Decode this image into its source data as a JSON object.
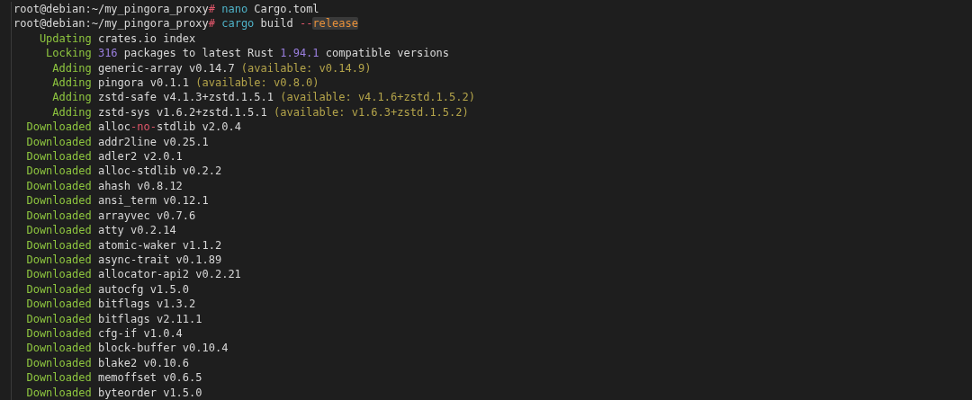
{
  "terminal": {
    "lines": [
      {
        "kind": "prompt",
        "segments": [
          {
            "text": "root@debian:~/my_pingora_proxy",
            "color": "#d8d8d8"
          },
          {
            "text": "#",
            "color": "#e0566a"
          },
          {
            "text": " nano",
            "color": "#4fb3c8"
          },
          {
            "text": " Cargo.toml",
            "color": "#d8d8d8"
          }
        ]
      },
      {
        "kind": "prompt",
        "segments": [
          {
            "text": "root@debian:~/my_pingora_proxy",
            "color": "#d8d8d8"
          },
          {
            "text": "#",
            "color": "#e0566a"
          },
          {
            "text": " cargo",
            "color": "#4fb3c8"
          },
          {
            "text": " build ",
            "color": "#d8d8d8"
          },
          {
            "text": "--",
            "color": "#e0566a"
          },
          {
            "text": "release",
            "color": "#e8913a",
            "highlighted": true
          }
        ]
      },
      {
        "kind": "status",
        "status": "Updating",
        "segments": [
          {
            "text": "crates.io index",
            "color": "#d8d8d8"
          }
        ]
      },
      {
        "kind": "status",
        "status": "Locking",
        "segments": [
          {
            "text": "316",
            "color": "#9b7fe0"
          },
          {
            "text": " packages to latest Rust ",
            "color": "#d8d8d8"
          },
          {
            "text": "1.94.1",
            "color": "#9b7fe0"
          },
          {
            "text": " compatible versions",
            "color": "#d8d8d8"
          }
        ]
      },
      {
        "kind": "status",
        "status": "Adding",
        "segments": [
          {
            "text": "generic-array v0.14.7 ",
            "color": "#d8d8d8"
          },
          {
            "text": "(available: v0.14.9)",
            "color": "#b4a44a"
          }
        ]
      },
      {
        "kind": "status",
        "status": "Adding",
        "segments": [
          {
            "text": "pingora v0.1.1 ",
            "color": "#d8d8d8"
          },
          {
            "text": "(available: v0.8.0)",
            "color": "#b4a44a"
          }
        ]
      },
      {
        "kind": "status",
        "status": "Adding",
        "segments": [
          {
            "text": "zstd-safe v4.1.3+zstd.1.5.1 ",
            "color": "#d8d8d8"
          },
          {
            "text": "(available: v4.1.6+zstd.1.5.2)",
            "color": "#b4a44a"
          }
        ]
      },
      {
        "kind": "status",
        "status": "Adding",
        "segments": [
          {
            "text": "zstd-sys v1.6.2+zstd.1.5.1 ",
            "color": "#d8d8d8"
          },
          {
            "text": "(available: v1.6.3+zstd.1.5.2)",
            "color": "#b4a44a"
          }
        ]
      },
      {
        "kind": "status",
        "status": "Downloaded",
        "segments": [
          {
            "text": "alloc",
            "color": "#d8d8d8"
          },
          {
            "text": "-no-",
            "color": "#e0566a"
          },
          {
            "text": "stdlib v2.0.4",
            "color": "#d8d8d8"
          }
        ]
      },
      {
        "kind": "status",
        "status": "Downloaded",
        "segments": [
          {
            "text": "addr2line v0.25.1",
            "color": "#d8d8d8"
          }
        ]
      },
      {
        "kind": "status",
        "status": "Downloaded",
        "segments": [
          {
            "text": "adler2 v2.0.1",
            "color": "#d8d8d8"
          }
        ]
      },
      {
        "kind": "status",
        "status": "Downloaded",
        "segments": [
          {
            "text": "alloc-stdlib v0.2.2",
            "color": "#d8d8d8"
          }
        ]
      },
      {
        "kind": "status",
        "status": "Downloaded",
        "segments": [
          {
            "text": "ahash v0.8.12",
            "color": "#d8d8d8"
          }
        ]
      },
      {
        "kind": "status",
        "status": "Downloaded",
        "segments": [
          {
            "text": "ansi_term v0.12.1",
            "color": "#d8d8d8"
          }
        ]
      },
      {
        "kind": "status",
        "status": "Downloaded",
        "segments": [
          {
            "text": "arrayvec v0.7.6",
            "color": "#d8d8d8"
          }
        ]
      },
      {
        "kind": "status",
        "status": "Downloaded",
        "segments": [
          {
            "text": "atty v0.2.14",
            "color": "#d8d8d8"
          }
        ]
      },
      {
        "kind": "status",
        "status": "Downloaded",
        "segments": [
          {
            "text": "atomic-waker v1.1.2",
            "color": "#d8d8d8"
          }
        ]
      },
      {
        "kind": "status",
        "status": "Downloaded",
        "segments": [
          {
            "text": "async-trait v0.1.89",
            "color": "#d8d8d8"
          }
        ]
      },
      {
        "kind": "status",
        "status": "Downloaded",
        "segments": [
          {
            "text": "allocator-api2 v0.2.21",
            "color": "#d8d8d8"
          }
        ]
      },
      {
        "kind": "status",
        "status": "Downloaded",
        "segments": [
          {
            "text": "autocfg v1.5.0",
            "color": "#d8d8d8"
          }
        ]
      },
      {
        "kind": "status",
        "status": "Downloaded",
        "segments": [
          {
            "text": "bitflags v1.3.2",
            "color": "#d8d8d8"
          }
        ]
      },
      {
        "kind": "status",
        "status": "Downloaded",
        "segments": [
          {
            "text": "bitflags v2.11.1",
            "color": "#d8d8d8"
          }
        ]
      },
      {
        "kind": "status",
        "status": "Downloaded",
        "segments": [
          {
            "text": "cfg-if v1.0.4",
            "color": "#d8d8d8"
          }
        ]
      },
      {
        "kind": "status",
        "status": "Downloaded",
        "segments": [
          {
            "text": "block-buffer v0.10.4",
            "color": "#d8d8d8"
          }
        ]
      },
      {
        "kind": "status",
        "status": "Downloaded",
        "segments": [
          {
            "text": "blake2 v0.10.6",
            "color": "#d8d8d8"
          }
        ]
      },
      {
        "kind": "status",
        "status": "Downloaded",
        "segments": [
          {
            "text": "memoffset v0.6.5",
            "color": "#d8d8d8"
          }
        ]
      },
      {
        "kind": "status",
        "status": "Downloaded",
        "segments": [
          {
            "text": "byteorder v1.5.0",
            "color": "#d8d8d8"
          }
        ]
      }
    ]
  }
}
